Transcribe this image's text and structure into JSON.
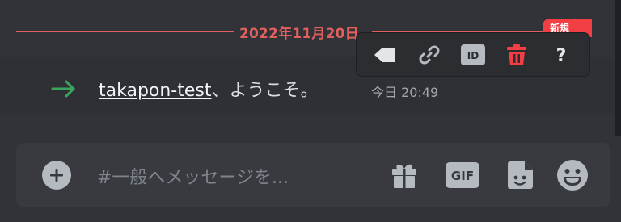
{
  "divider": {
    "date": "2022年11月20日",
    "new_badge": "新規"
  },
  "toolbar": {
    "items": [
      "tag-icon",
      "link-icon",
      "copy-id-icon",
      "delete-icon",
      "help-icon"
    ],
    "id_label": "ID",
    "help_label": "?"
  },
  "message": {
    "username": "takapon-test",
    "text": "、ようこそ。",
    "timestamp": "今日 20:49"
  },
  "composer": {
    "placeholder": "#一般へメッセージを...",
    "gif_label": "GIF"
  },
  "colors": {
    "accent_red": "#e0605d",
    "join_green": "#3ba55c",
    "background": "#313338"
  }
}
